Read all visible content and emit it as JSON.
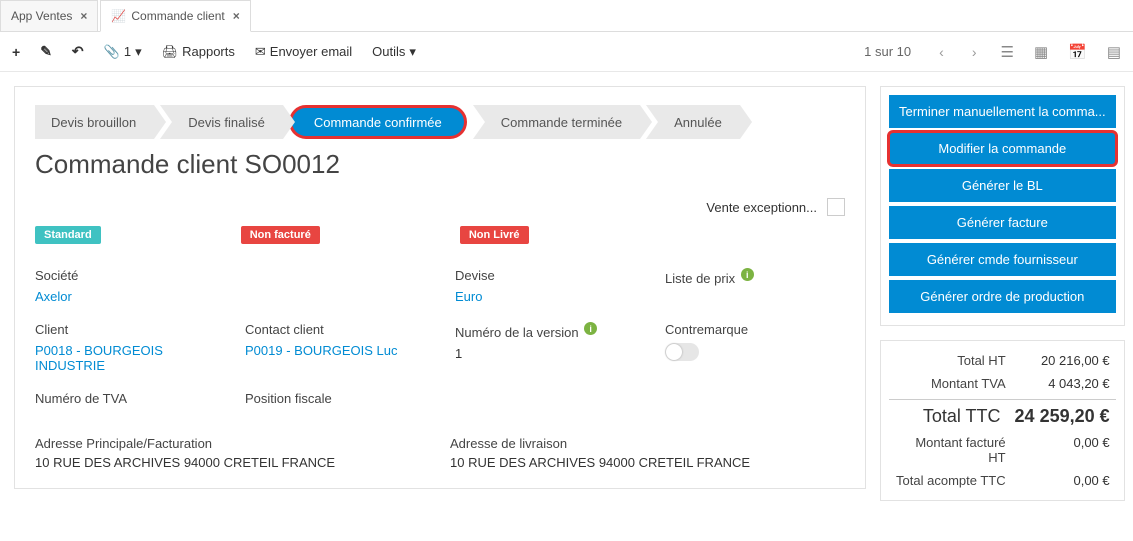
{
  "tabs": [
    {
      "label": "App Ventes",
      "closable": true,
      "active": false
    },
    {
      "label": "Commande client",
      "closable": true,
      "active": true
    }
  ],
  "toolbar": {
    "new_label": "+",
    "edit_label": "✎",
    "undo_label": "↶",
    "attach_count": "1",
    "reports_label": "Rapports",
    "email_label": "Envoyer email",
    "tools_label": "Outils",
    "pager": "1 sur 10"
  },
  "status_steps": [
    "Devis brouillon",
    "Devis finalisé",
    "Commande confirmée",
    "Commande terminée",
    "Annulée"
  ],
  "status_active_index": 2,
  "title": "Commande client SO0012",
  "vente_exception_label": "Vente exceptionn...",
  "badges": [
    {
      "text": "Standard",
      "variant": "teal"
    },
    {
      "text": "Non facturé",
      "variant": "red"
    },
    {
      "text": "Non Livré",
      "variant": "red"
    }
  ],
  "fields": {
    "societe_label": "Société",
    "societe_value": "Axelor",
    "devise_label": "Devise",
    "devise_value": "Euro",
    "liste_prix_label": "Liste de prix",
    "client_label": "Client",
    "client_value": "P0018 - BOURGEOIS INDUSTRIE",
    "contact_label": "Contact client",
    "contact_value": "P0019 - BOURGEOIS Luc",
    "version_label": "Numéro de la version",
    "version_value": "1",
    "contremarque_label": "Contremarque",
    "tva_label": "Numéro de TVA",
    "tva_value": "",
    "position_label": "Position fiscale",
    "position_value": ""
  },
  "addresses": {
    "billing_label": "Adresse Principale/Facturation",
    "billing_value": "10 RUE DES ARCHIVES 94000 CRETEIL FRANCE",
    "delivery_label": "Adresse de livraison",
    "delivery_value": "10 RUE DES ARCHIVES 94000 CRETEIL FRANCE"
  },
  "actions": [
    "Terminer manuellement la comma...",
    "Modifier la commande",
    "Générer le BL",
    "Générer facture",
    "Générer cmde fournisseur",
    "Générer ordre de production"
  ],
  "actions_highlight_index": 1,
  "totals": {
    "ht_label": "Total HT",
    "ht_value": "20 216,00 €",
    "tva_label": "Montant TVA",
    "tva_value": "4 043,20 €",
    "ttc_label": "Total TTC",
    "ttc_value": "24 259,20 €",
    "facture_ht_label": "Montant facturé HT",
    "facture_ht_value": "0,00 €",
    "acompte_label": "Total acompte TTC",
    "acompte_value": "0,00 €"
  }
}
